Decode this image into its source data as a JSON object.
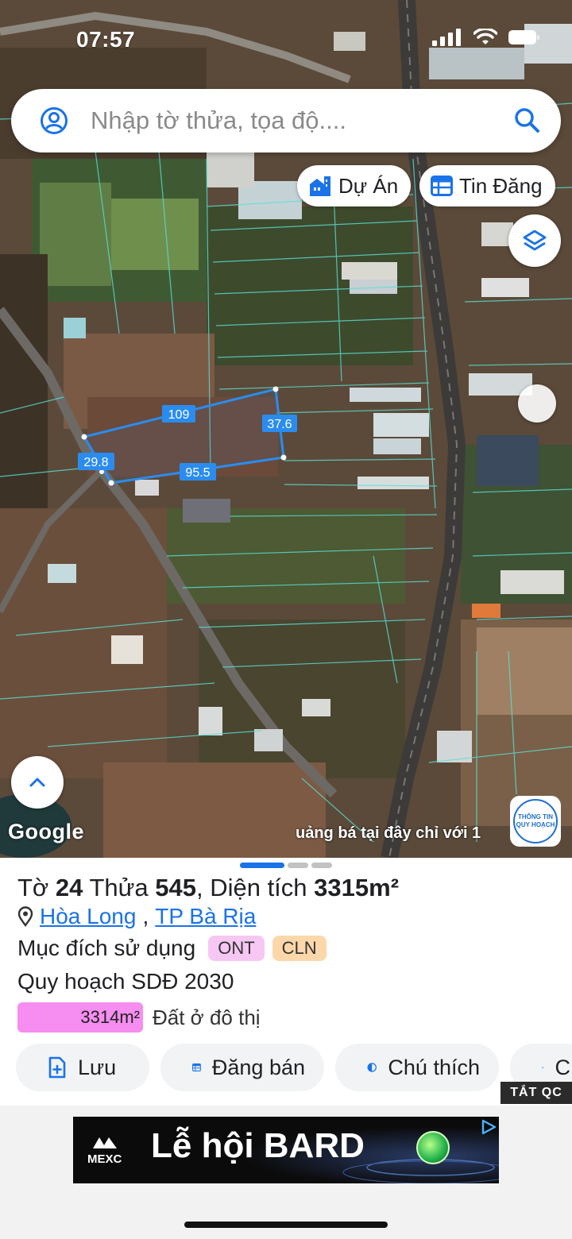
{
  "status": {
    "time": "07:57"
  },
  "search": {
    "placeholder": "Nhập tờ thửa, tọa độ...."
  },
  "chips": {
    "du_an": "Dự Án",
    "tin_dang": "Tin Đăng"
  },
  "parcel_lengths": {
    "top": "109",
    "right": "37.6",
    "bottom": "95.5",
    "left": "29.8"
  },
  "map_footer": {
    "google": "Google",
    "marquee": "uảng bá tại đây chỉ với 1",
    "badge_line1": "THÔNG TIN",
    "badge_line2": "QUY HOẠCH"
  },
  "parcel": {
    "label_to": "Tờ",
    "to": "24",
    "label_thua": "Thửa",
    "thua": "545",
    "label_area": "Diện tích",
    "area": "3315m²",
    "ward": "Hòa Long",
    "city": "TP Bà Rịa",
    "purpose_label": "Mục đích sử dụng",
    "purpose_tags": [
      "ONT",
      "CLN"
    ],
    "plan_label": "Quy hoạch SDĐ 2030",
    "plan_area": "3314m²",
    "plan_area_type": "Đất ở đô thị"
  },
  "actions": {
    "save": "Lưu",
    "post_sale": "Đăng bán",
    "legend": "Chú thích",
    "camera": "C"
  },
  "ads": {
    "hide_label": "TẮT QC",
    "brand": "MEXC",
    "headline": "Lễ hội BARD"
  },
  "colors": {
    "accent": "#1a73e8",
    "parcel_line": "#2b8cf0",
    "tag_ont": "#f7c7f3",
    "tag_cln": "#fcd7aa",
    "plan_bar": "#f58ef0"
  }
}
